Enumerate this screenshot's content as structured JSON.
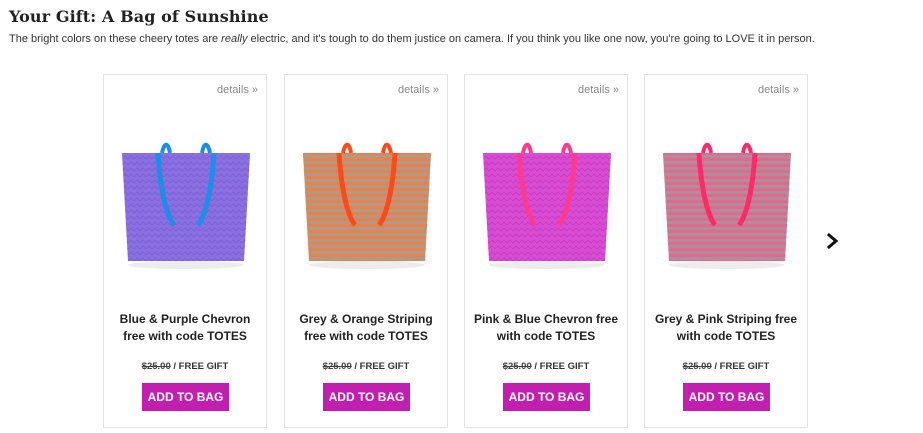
{
  "header": {
    "title": "Your Gift: A Bag of Sunshine",
    "intro_before": "The bright colors on these cheery totes are ",
    "intro_em": "really",
    "intro_after": " electric, and it's tough to do them justice on camera. If you think you like one now, you're going to LOVE it in person."
  },
  "products": [
    {
      "details_label": "details »",
      "name": "Blue & Purple Chevron free with code TOTES",
      "old_price": "$25.00",
      "price_separator": " / ",
      "gift_label": "FREE GIFT",
      "button_label": "ADD TO BAG",
      "bag_color": "#8a6fe0",
      "strap_color": "#1a8fe6",
      "pattern": "chevron",
      "pattern_color": "#7a5fd6"
    },
    {
      "details_label": "details »",
      "name": "Grey & Orange Striping free with code TOTES",
      "old_price": "$25.00",
      "price_separator": " / ",
      "gift_label": "FREE GIFT",
      "button_label": "ADD TO BAG",
      "bag_color": "#f07f45",
      "strap_color": "#ff4a1c",
      "pattern": "stripes",
      "pattern_color": "#a79d8e"
    },
    {
      "details_label": "details »",
      "name": "Pink & Blue Chevron free with code TOTES",
      "old_price": "$25.00",
      "price_separator": " / ",
      "gift_label": "FREE GIFT",
      "button_label": "ADD TO BAG",
      "bag_color": "#d94bd3",
      "strap_color": "#ff3a8c",
      "pattern": "chevron",
      "pattern_color": "#c43cc0"
    },
    {
      "details_label": "details »",
      "name": "Grey & Pink Striping free with code TOTES",
      "old_price": "$25.00",
      "price_separator": " / ",
      "gift_label": "FREE GIFT",
      "button_label": "ADD TO BAG",
      "bag_color": "#e8668e",
      "strap_color": "#ff2a6a",
      "pattern": "stripes",
      "pattern_color": "#a8919a"
    }
  ],
  "carousel": {
    "next_icon": "chevron-right-icon"
  },
  "colors": {
    "accent": "#c21fb1"
  }
}
